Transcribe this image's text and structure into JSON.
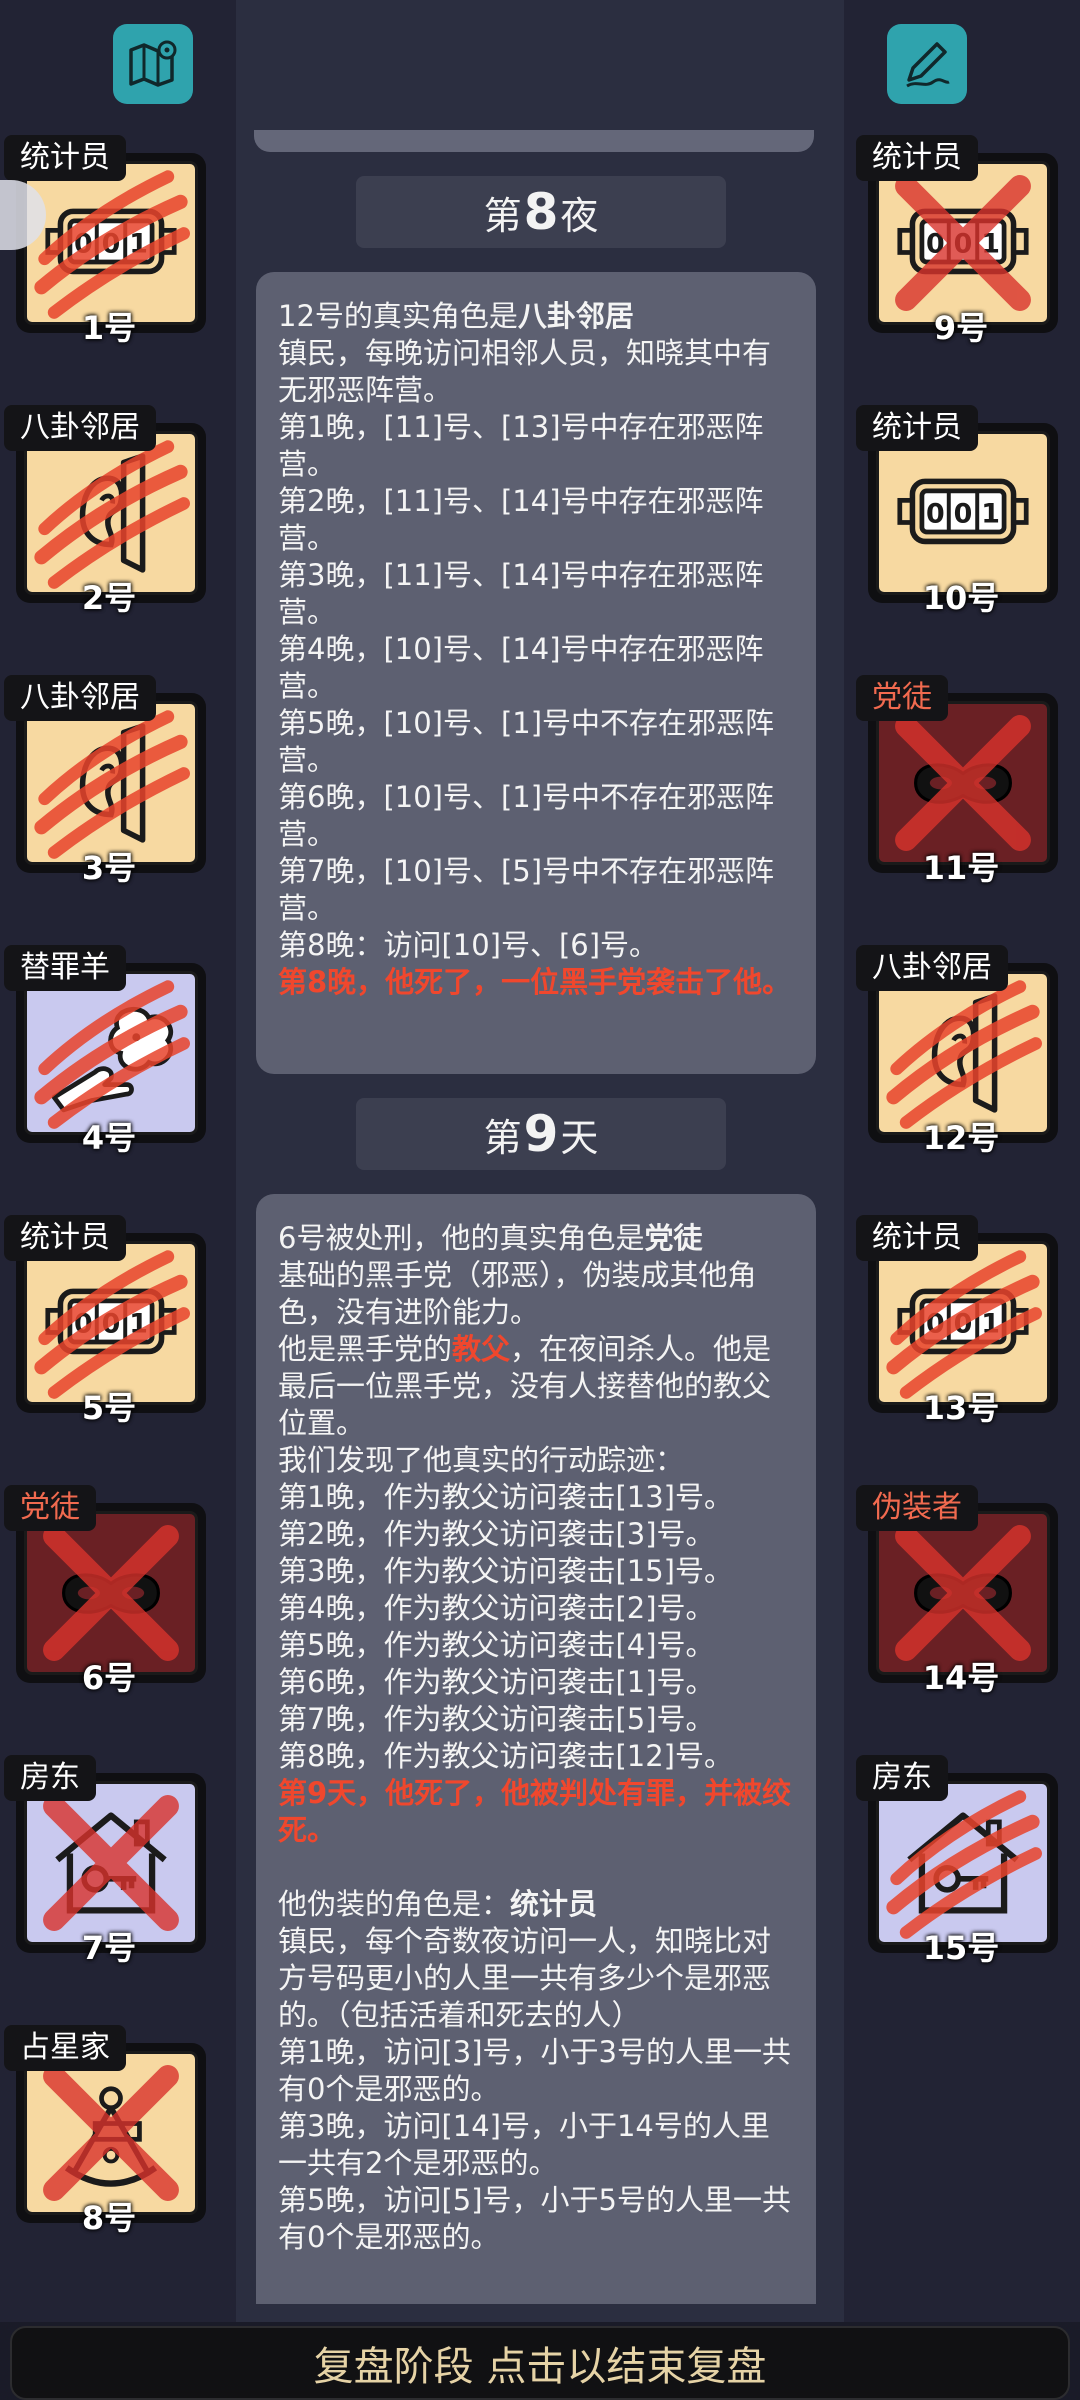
{
  "left_players": [
    {
      "role": "统计员",
      "num": "1号",
      "bg": "yellow",
      "icon": "counter",
      "overlay": "claw",
      "evil": false
    },
    {
      "role": "八卦邻居",
      "num": "2号",
      "bg": "yellow",
      "icon": "ear",
      "overlay": "claw",
      "evil": false
    },
    {
      "role": "八卦邻居",
      "num": "3号",
      "bg": "yellow",
      "icon": "ear",
      "overlay": "claw",
      "evil": false
    },
    {
      "role": "替罪羊",
      "num": "4号",
      "bg": "blue",
      "icon": "sheep",
      "overlay": "claw",
      "evil": false
    },
    {
      "role": "统计员",
      "num": "5号",
      "bg": "yellow",
      "icon": "counter",
      "overlay": "claw",
      "evil": false
    },
    {
      "role": "党徒",
      "num": "6号",
      "bg": "red",
      "icon": "mask",
      "overlay": "x",
      "evil": true
    },
    {
      "role": "房东",
      "num": "7号",
      "bg": "blue",
      "icon": "house",
      "overlay": "x",
      "evil": false
    },
    {
      "role": "占星家",
      "num": "8号",
      "bg": "yellow",
      "icon": "sextant",
      "overlay": "x",
      "evil": false
    }
  ],
  "right_players": [
    {
      "role": "统计员",
      "num": "9号",
      "bg": "yellow",
      "icon": "counter",
      "overlay": "x",
      "evil": false
    },
    {
      "role": "统计员",
      "num": "10号",
      "bg": "yellow",
      "icon": "counter",
      "overlay": "none",
      "evil": false
    },
    {
      "role": "党徒",
      "num": "11号",
      "bg": "red",
      "icon": "mask",
      "overlay": "x",
      "evil": true
    },
    {
      "role": "八卦邻居",
      "num": "12号",
      "bg": "yellow",
      "icon": "ear",
      "overlay": "claw",
      "evil": false
    },
    {
      "role": "统计员",
      "num": "13号",
      "bg": "yellow",
      "icon": "counter",
      "overlay": "claw",
      "evil": false
    },
    {
      "role": "伪装者",
      "num": "14号",
      "bg": "red",
      "icon": "mask",
      "overlay": "x",
      "evil": true
    },
    {
      "role": "房东",
      "num": "15号",
      "bg": "blue",
      "icon": "house",
      "overlay": "claw",
      "evil": false
    }
  ],
  "night_heading": {
    "prefix": "第",
    "num": "8",
    "suffix": "夜"
  },
  "night_card": {
    "lines": [
      {
        "pre": "12号的真实角色是",
        "b": "八卦邻居"
      },
      "镇民，每晚访问相邻人员，知晓其中有无邪恶阵营。",
      "第1晚，[11]号、[13]号中存在邪恶阵营。",
      "第2晚，[11]号、[14]号中存在邪恶阵营。",
      "第3晚，[11]号、[14]号中存在邪恶阵营。",
      "第4晚，[10]号、[14]号中存在邪恶阵营。",
      "第5晚，[10]号、[1]号中不存在邪恶阵营。",
      "第6晚，[10]号、[1]号中不存在邪恶阵营。",
      "第7晚，[10]号、[5]号中不存在邪恶阵营。",
      "第8晚：访问[10]号、[6]号。"
    ],
    "death": "第8晚，他死了，一位黑手党袭击了他。"
  },
  "day_heading": {
    "prefix": "第",
    "num": "9",
    "suffix": "天"
  },
  "day_card": {
    "intro_pre": "6号被处刑，他的真实角色是",
    "intro_b": "党徒",
    "desc1": "基础的黑手党（邪恶），伪装成其他角色，没有进阶能力。",
    "desc2_pre": "他是黑手党的",
    "desc2_red": "教父",
    "desc2_post": "，在夜间杀人。他是最后一位黑手党，没有人接替他的教父位置。",
    "track_title": "我们发现了他真实的行动踪迹：",
    "tracks": [
      "第1晚，作为教父访问袭击[13]号。",
      "第2晚，作为教父访问袭击[3]号。",
      "第3晚，作为教父访问袭击[15]号。",
      "第4晚，作为教父访问袭击[2]号。",
      "第5晚，作为教父访问袭击[4]号。",
      "第6晚，作为教父访问袭击[1]号。",
      "第7晚，作为教父访问袭击[5]号。",
      "第8晚，作为教父访问袭击[12]号。"
    ],
    "verdict": "第9天，他死了，他被判处有罪，并被绞死。",
    "disguise_pre": "他伪装的角色是：",
    "disguise_b": "统计员",
    "disguise_desc": "镇民，每个奇数夜访问一人，知晓比对方号码更小的人里一共有多少个是邪恶的。（包括活着和死去的人）",
    "disguise_lines": [
      "第1晚，访问[3]号，小于3号的人里一共有0个是邪恶的。",
      "第3晚，访问[14]号，小于14号的人里一共有2个是邪恶的。",
      "第5晚，访问[5]号，小于5号的人里一共有0个是邪恶的。"
    ]
  },
  "bottom_button": "复盘阶段 点击以结束复盘",
  "icons": {
    "top_left": "map-icon",
    "top_right": "notepad-pen-icon"
  },
  "colors": {
    "evil_text": "#f0472d",
    "accent": "#2fa3ad"
  }
}
